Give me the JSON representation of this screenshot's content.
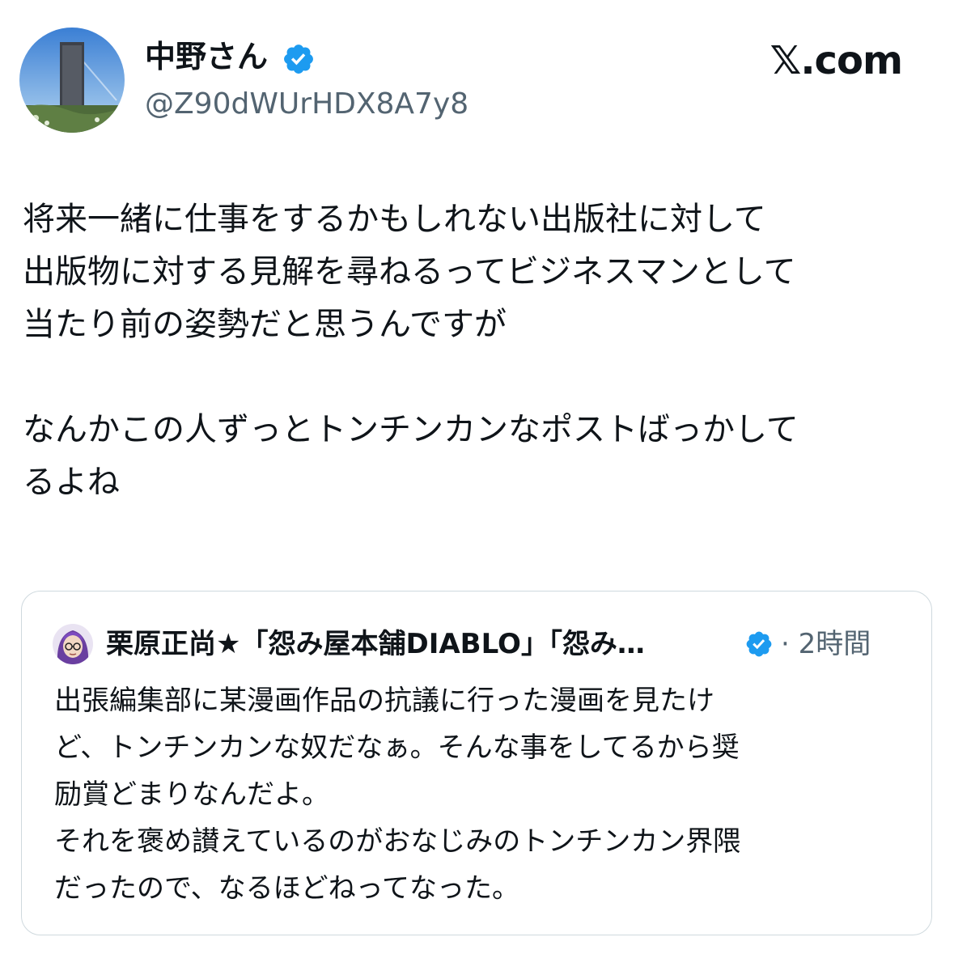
{
  "post": {
    "author": {
      "display_name": "中野さん",
      "handle": "@Z90dWUrHDX8A7y8",
      "verified": true,
      "avatar_icon": "profile-photo-tower-icon"
    },
    "brand": "𝕏.com",
    "body_lines": [
      "将来一緒に仕事をするかもしれない出版社に対して",
      "出版物に対する見解を尋ねるってビジネスマンとして",
      "当たり前の姿勢だと思うんですが",
      "",
      "なんかこの人ずっとトンチンカンなポストばっかして",
      "るよね"
    ]
  },
  "quoted_post": {
    "display_name": "栗原正尚★「怨み屋本舗DIABLO」「怨み…",
    "verified": true,
    "time_label": "· 2時間",
    "avatar_icon": "profile-photo-anime-character-icon",
    "body_lines": [
      "出張編集部に某漫画作品の抗議に行った漫画を見たけ",
      "ど、トンチンカンな奴だなぁ。そんな事をしてるから奨",
      "励賞どまりなんだよ。",
      "それを褒め讃えているのがおなじみのトンチンカン界隈",
      "だったので、なるほどねってなった。"
    ]
  },
  "colors": {
    "text_primary": "#0f1419",
    "text_secondary": "#536471",
    "verified_blue": "#1d9bf0",
    "card_border": "#cfd9de",
    "background": "#ffffff"
  }
}
